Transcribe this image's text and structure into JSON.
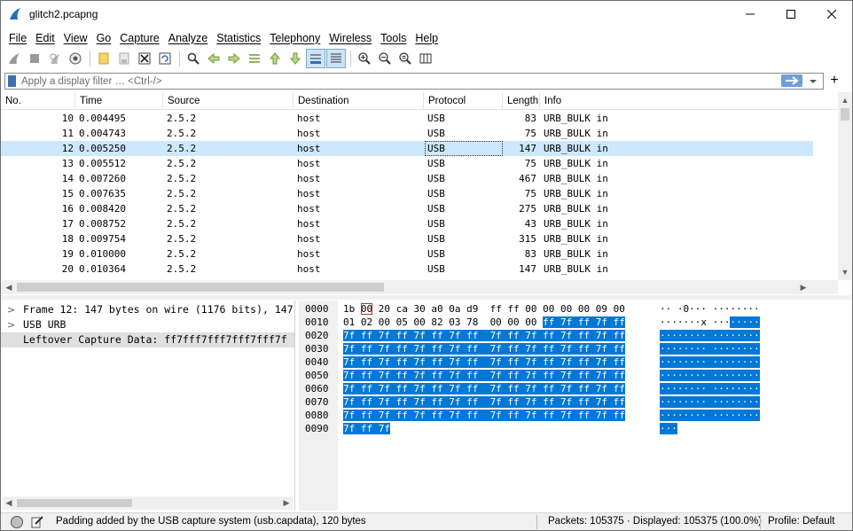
{
  "window": {
    "title": "glitch2.pcapng",
    "accent_color": "#0078d7"
  },
  "menu": [
    "File",
    "Edit",
    "View",
    "Go",
    "Capture",
    "Analyze",
    "Statistics",
    "Telephony",
    "Wireless",
    "Tools",
    "Help"
  ],
  "toolbar": {
    "icons": [
      "shark-fin-start-icon",
      "stop-square-icon",
      "restart-fin-icon",
      "capture-options-icon",
      "open-folder-icon",
      "save-file-icon",
      "close-file-icon",
      "reload-icon",
      "find-packet-icon",
      "go-back-icon",
      "go-forward-icon",
      "go-to-packet-icon",
      "go-first-icon",
      "go-last-icon",
      "auto-scroll-icon",
      "colorize-icon",
      "zoom-in-icon",
      "zoom-out-icon",
      "normal-size-icon",
      "resize-columns-icon"
    ]
  },
  "filter": {
    "placeholder": "Apply a display filter … <Ctrl-/>"
  },
  "packet_list": {
    "columns": [
      "No.",
      "Time",
      "Source",
      "Destination",
      "Protocol",
      "Length",
      "Info"
    ],
    "selected_index": 2,
    "rows": [
      {
        "no": "10",
        "time": "0.004495",
        "src": "2.5.2",
        "dst": "host",
        "proto": "USB",
        "len": "83",
        "info": "URB_BULK in"
      },
      {
        "no": "11",
        "time": "0.004743",
        "src": "2.5.2",
        "dst": "host",
        "proto": "USB",
        "len": "75",
        "info": "URB_BULK in"
      },
      {
        "no": "12",
        "time": "0.005250",
        "src": "2.5.2",
        "dst": "host",
        "proto": "USB",
        "len": "147",
        "info": "URB_BULK in"
      },
      {
        "no": "13",
        "time": "0.005512",
        "src": "2.5.2",
        "dst": "host",
        "proto": "USB",
        "len": "75",
        "info": "URB_BULK in"
      },
      {
        "no": "14",
        "time": "0.007260",
        "src": "2.5.2",
        "dst": "host",
        "proto": "USB",
        "len": "467",
        "info": "URB_BULK in"
      },
      {
        "no": "15",
        "time": "0.007635",
        "src": "2.5.2",
        "dst": "host",
        "proto": "USB",
        "len": "75",
        "info": "URB_BULK in"
      },
      {
        "no": "16",
        "time": "0.008420",
        "src": "2.5.2",
        "dst": "host",
        "proto": "USB",
        "len": "275",
        "info": "URB_BULK in"
      },
      {
        "no": "17",
        "time": "0.008752",
        "src": "2.5.2",
        "dst": "host",
        "proto": "USB",
        "len": "43",
        "info": "URB_BULK in"
      },
      {
        "no": "18",
        "time": "0.009754",
        "src": "2.5.2",
        "dst": "host",
        "proto": "USB",
        "len": "315",
        "info": "URB_BULK in"
      },
      {
        "no": "19",
        "time": "0.010000",
        "src": "2.5.2",
        "dst": "host",
        "proto": "USB",
        "len": "83",
        "info": "URB_BULK in"
      },
      {
        "no": "20",
        "time": "0.010364",
        "src": "2.5.2",
        "dst": "host",
        "proto": "USB",
        "len": "147",
        "info": "URB_BULK in"
      }
    ]
  },
  "details": {
    "items": [
      {
        "arrow": ">",
        "text": "Frame 12: 147 bytes on wire (1176 bits), 147"
      },
      {
        "arrow": ">",
        "text": "USB URB"
      },
      {
        "arrow": "",
        "text": "Leftover Capture Data: ff7fff7fff7fff7fff7f"
      }
    ]
  },
  "bytes": {
    "rows": [
      {
        "off": "0000",
        "hex_a": "1b ",
        "hex_box": "00",
        "hex_b": " 20 ca 30 a0 0a d9  ff ff 00 00 00 00 09 00",
        "hex_hl": "",
        "asc_a": "·· ·0··· ········",
        "asc_hl": ""
      },
      {
        "off": "0010",
        "hex_a": "01 02 00 05 00 82 03 78  00 00 00 ",
        "hex_box": "",
        "hex_b": "",
        "hex_hl": "ff 7f ff 7f ff",
        "asc_a": "·······x ···",
        "asc_hl": "·····"
      },
      {
        "off": "0020",
        "hex_a": "",
        "hex_box": "",
        "hex_b": "",
        "hex_hl": "7f ff 7f ff 7f ff 7f ff  7f ff 7f ff 7f ff 7f ff",
        "asc_a": "",
        "asc_hl": "········ ········"
      },
      {
        "off": "0030",
        "hex_a": "",
        "hex_box": "",
        "hex_b": "",
        "hex_hl": "7f ff 7f ff 7f ff 7f ff  7f ff 7f ff 7f ff 7f ff",
        "asc_a": "",
        "asc_hl": "········ ········"
      },
      {
        "off": "0040",
        "hex_a": "",
        "hex_box": "",
        "hex_b": "",
        "hex_hl": "7f ff 7f ff 7f ff 7f ff  7f ff 7f ff 7f ff 7f ff",
        "asc_a": "",
        "asc_hl": "········ ········"
      },
      {
        "off": "0050",
        "hex_a": "",
        "hex_box": "",
        "hex_b": "",
        "hex_hl": "7f ff 7f ff 7f ff 7f ff  7f ff 7f ff 7f ff 7f ff",
        "asc_a": "",
        "asc_hl": "········ ········"
      },
      {
        "off": "0060",
        "hex_a": "",
        "hex_box": "",
        "hex_b": "",
        "hex_hl": "7f ff 7f ff 7f ff 7f ff  7f ff 7f ff 7f ff 7f ff",
        "asc_a": "",
        "asc_hl": "········ ········"
      },
      {
        "off": "0070",
        "hex_a": "",
        "hex_box": "",
        "hex_b": "",
        "hex_hl": "7f ff 7f ff 7f ff 7f ff  7f ff 7f ff 7f ff 7f ff",
        "asc_a": "",
        "asc_hl": "········ ········"
      },
      {
        "off": "0080",
        "hex_a": "",
        "hex_box": "",
        "hex_b": "",
        "hex_hl": "7f ff 7f ff 7f ff 7f ff  7f ff 7f ff 7f ff 7f ff",
        "asc_a": "",
        "asc_hl": "········ ········"
      },
      {
        "off": "0090",
        "hex_a": "",
        "hex_box": "",
        "hex_b": "",
        "hex_hl": "7f ff 7f",
        "asc_a": "",
        "asc_hl": "···"
      }
    ]
  },
  "status": {
    "message": "Padding added by the USB capture system (usb.capdata), 120 bytes",
    "packets": "Packets: 105375 · Displayed: 105375 (100.0%)",
    "profile": "Profile: Default"
  }
}
